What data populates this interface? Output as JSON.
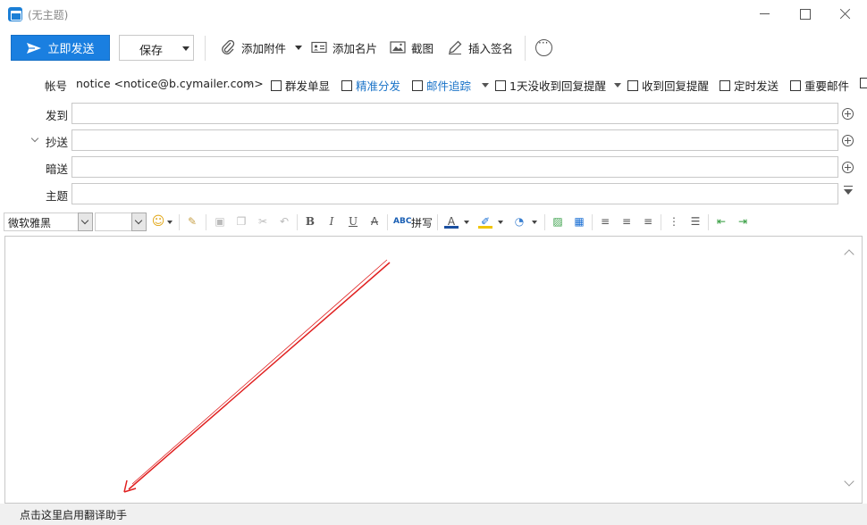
{
  "window": {
    "title": "(无主题)"
  },
  "toolbar": {
    "send_label": "立即发送",
    "save_label": "保存",
    "attach_label": "添加附件",
    "card_label": "添加名片",
    "screenshot_label": "截图",
    "signature_label": "插入签名"
  },
  "account": {
    "label": "帐号",
    "value": "notice <notice@b.cymailer.com>",
    "options": [
      {
        "label": "群发单显",
        "checked": false,
        "blue": false
      },
      {
        "label": "精准分发",
        "checked": false,
        "blue": true
      },
      {
        "label": "邮件追踪",
        "checked": false,
        "blue": true
      },
      {
        "label": "1天没收到回复提醒",
        "checked": false,
        "blue": false
      },
      {
        "label": "收到回复提醒",
        "checked": false,
        "blue": false
      },
      {
        "label": "定时发送",
        "checked": false,
        "blue": false
      },
      {
        "label": "重要邮件",
        "checked": false,
        "blue": false
      }
    ]
  },
  "fields": {
    "to_label": "发到",
    "cc_label": "抄送",
    "bcc_label": "暗送",
    "subject_label": "主题",
    "to_value": "",
    "cc_value": "",
    "bcc_value": "",
    "subject_value": ""
  },
  "format": {
    "font": "微软雅黑",
    "size": "",
    "spell_label": "拼写"
  },
  "status": {
    "translate_hint": "点击这里启用翻译助手"
  },
  "colors": {
    "accent": "#1a7fe0",
    "annotation_arrow": "#e02020"
  }
}
